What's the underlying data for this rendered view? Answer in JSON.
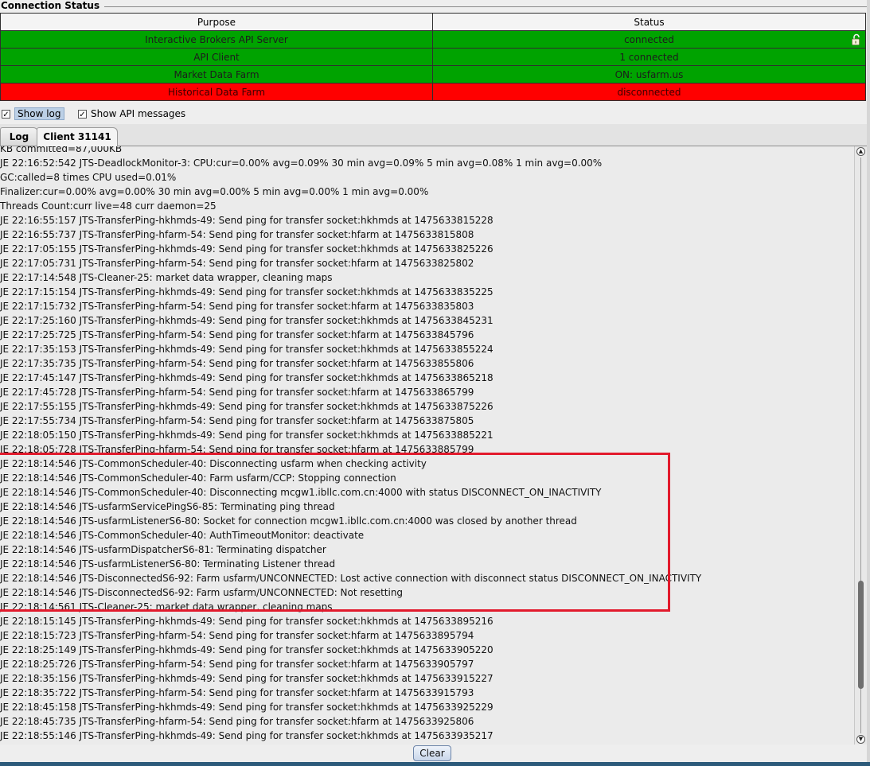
{
  "section": {
    "title": "Connection Status"
  },
  "table": {
    "headers": {
      "purpose": "Purpose",
      "status": "Status"
    },
    "rows": [
      {
        "purpose": "Interactive Brokers API Server",
        "status": "connected",
        "color": "#00a300",
        "icon": "unlocked-padlock-icon"
      },
      {
        "purpose": "API Client",
        "status": "1 connected",
        "color": "#00a300"
      },
      {
        "purpose": "Market Data Farm",
        "status": "ON: usfarm.us",
        "color": "#00a300"
      },
      {
        "purpose": "Historical Data Farm",
        "status": "disconnected",
        "color": "#ff0000"
      }
    ]
  },
  "options": {
    "show_log": {
      "label": "Show log",
      "checked": true
    },
    "show_api_messages": {
      "label": "Show API messages",
      "checked": true
    }
  },
  "tabs": [
    {
      "label": "Log",
      "active": false
    },
    {
      "label": "Client 31141",
      "active": true
    }
  ],
  "log_lines": [
    "KB committed=87,000KB",
    "JE 22:16:52:542 JTS-DeadlockMonitor-3: CPU:cur=0.00% avg=0.09% 30 min avg=0.09% 5 min avg=0.08% 1 min avg=0.00%",
    "GC:called=8 times CPU used=0.01%",
    "Finalizer:cur=0.00% avg=0.00% 30 min avg=0.00% 5 min avg=0.00% 1 min avg=0.00%",
    "Threads Count:curr live=48 curr daemon=25",
    "JE 22:16:55:157 JTS-TransferPing-hkhmds-49: Send ping for transfer socket:hkhmds at 1475633815228",
    "JE 22:16:55:737 JTS-TransferPing-hfarm-54: Send ping for transfer socket:hfarm at 1475633815808",
    "JE 22:17:05:155 JTS-TransferPing-hkhmds-49: Send ping for transfer socket:hkhmds at 1475633825226",
    "JE 22:17:05:731 JTS-TransferPing-hfarm-54: Send ping for transfer socket:hfarm at 1475633825802",
    "JE 22:17:14:548 JTS-Cleaner-25: market data wrapper, cleaning maps",
    "JE 22:17:15:154 JTS-TransferPing-hkhmds-49: Send ping for transfer socket:hkhmds at 1475633835225",
    "JE 22:17:15:732 JTS-TransferPing-hfarm-54: Send ping for transfer socket:hfarm at 1475633835803",
    "JE 22:17:25:160 JTS-TransferPing-hkhmds-49: Send ping for transfer socket:hkhmds at 1475633845231",
    "JE 22:17:25:725 JTS-TransferPing-hfarm-54: Send ping for transfer socket:hfarm at 1475633845796",
    "JE 22:17:35:153 JTS-TransferPing-hkhmds-49: Send ping for transfer socket:hkhmds at 1475633855224",
    "JE 22:17:35:735 JTS-TransferPing-hfarm-54: Send ping for transfer socket:hfarm at 1475633855806",
    "JE 22:17:45:147 JTS-TransferPing-hkhmds-49: Send ping for transfer socket:hkhmds at 1475633865218",
    "JE 22:17:45:728 JTS-TransferPing-hfarm-54: Send ping for transfer socket:hfarm at 1475633865799",
    "JE 22:17:55:155 JTS-TransferPing-hkhmds-49: Send ping for transfer socket:hkhmds at 1475633875226",
    "JE 22:17:55:734 JTS-TransferPing-hfarm-54: Send ping for transfer socket:hfarm at 1475633875805",
    "JE 22:18:05:150 JTS-TransferPing-hkhmds-49: Send ping for transfer socket:hkhmds at 1475633885221",
    "JE 22:18:05:728 JTS-TransferPing-hfarm-54: Send ping for transfer socket:hfarm at 1475633885799",
    "JE 22:18:14:546 JTS-CommonScheduler-40: Disconnecting usfarm when checking activity",
    "JE 22:18:14:546 JTS-CommonScheduler-40: Farm usfarm/CCP: Stopping connection",
    "JE 22:18:14:546 JTS-CommonScheduler-40: Disconnecting mcgw1.ibllc.com.cn:4000 with status DISCONNECT_ON_INACTIVITY",
    "JE 22:18:14:546 JTS-usfarmServicePingS6-85: Terminating ping thread",
    "JE 22:18:14:546 JTS-usfarmListenerS6-80: Socket for connection mcgw1.ibllc.com.cn:4000 was closed by another thread",
    "JE 22:18:14:546 JTS-CommonScheduler-40: AuthTimeoutMonitor: deactivate",
    "JE 22:18:14:546 JTS-usfarmDispatcherS6-81: Terminating dispatcher",
    "JE 22:18:14:546 JTS-usfarmListenerS6-80: Terminating Listener thread",
    "JE 22:18:14:546 JTS-DisconnectedS6-92: Farm usfarm/UNCONNECTED: Lost active connection with disconnect status DISCONNECT_ON_INACTIVITY",
    "JE 22:18:14:546 JTS-DisconnectedS6-92: Farm usfarm/UNCONNECTED: Not resetting",
    "JE 22:18:14:561 JTS-Cleaner-25: market data wrapper, cleaning maps",
    "JE 22:18:15:145 JTS-TransferPing-hkhmds-49: Send ping for transfer socket:hkhmds at 1475633895216",
    "JE 22:18:15:723 JTS-TransferPing-hfarm-54: Send ping for transfer socket:hfarm at 1475633895794",
    "JE 22:18:25:149 JTS-TransferPing-hkhmds-49: Send ping for transfer socket:hkhmds at 1475633905220",
    "JE 22:18:25:726 JTS-TransferPing-hfarm-54: Send ping for transfer socket:hfarm at 1475633905797",
    "JE 22:18:35:156 JTS-TransferPing-hkhmds-49: Send ping for transfer socket:hkhmds at 1475633915227",
    "JE 22:18:35:722 JTS-TransferPing-hfarm-54: Send ping for transfer socket:hfarm at 1475633915793",
    "JE 22:18:45:158 JTS-TransferPing-hkhmds-49: Send ping for transfer socket:hkhmds at 1475633925229",
    "JE 22:18:45:735 JTS-TransferPing-hfarm-54: Send ping for transfer socket:hfarm at 1475633925806",
    "JE 22:18:55:146 JTS-TransferPing-hkhmds-49: Send ping for transfer socket:hkhmds at 1475633935217"
  ],
  "clear_button": {
    "label": "Clear"
  },
  "colors": {
    "highlight": "#e21a2c",
    "connected": "#00a300",
    "disconnected": "#ff0000"
  }
}
